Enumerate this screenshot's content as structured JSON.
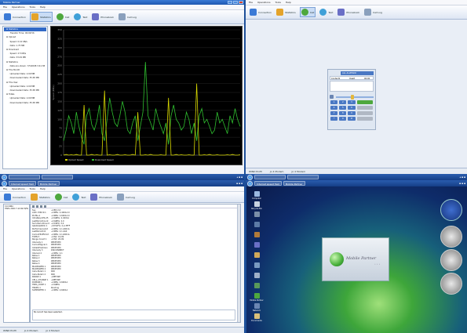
{
  "panes": {
    "tl": {
      "title": "Mobile Partner",
      "menu": [
        "File",
        "Operations",
        "Tools",
        "Help"
      ],
      "toolbar": [
        "Connection",
        "Statistics",
        "Call",
        "Text",
        "Phonebook",
        "Call Log"
      ],
      "tree": [
        {
          "text": "Statistics",
          "level": 0,
          "selected": true
        },
        {
          "text": "Transfer Time: 00:09:56",
          "level": 1
        },
        {
          "text": "Upload",
          "level": 0
        },
        {
          "text": "Speed: 0.10 KB/s",
          "level": 1
        },
        {
          "text": "Data: 1.75 MB",
          "level": 1
        },
        {
          "text": "Download",
          "level": 0
        },
        {
          "text": "Speed: 2.5 KB/s",
          "level": 1
        },
        {
          "text": "Data: 33.29 MB",
          "level": 1
        },
        {
          "text": "Statistics",
          "level": 0
        },
        {
          "text": "Date are shown: 7/5/2008 3:41:38",
          "level": 1
        },
        {
          "text": "This Month",
          "level": 0
        },
        {
          "text": "Uploaded Data: 2.09 MB",
          "level": 1
        },
        {
          "text": "Downloaded Data: 35.58 MB",
          "level": 1
        },
        {
          "text": "This Year",
          "level": 0
        },
        {
          "text": "Uploaded Data: 2.09 MB",
          "level": 1
        },
        {
          "text": "Downloaded Data: 35.58 MB",
          "level": 1
        },
        {
          "text": "Totals",
          "level": 0
        },
        {
          "text": "Uploaded Data: 2.09 MB",
          "level": 1
        },
        {
          "text": "Downloaded Data: 35.58 MB",
          "level": 1
        }
      ],
      "legend": [
        "Upload Speed",
        "Download Speed"
      ],
      "status": [
        "WIND Profil",
        "Jo 4 Modem",
        "Jo 4 Modem"
      ]
    },
    "tr": {
      "menu": [
        "File",
        "Operations",
        "Tools",
        "Help"
      ],
      "toolbar": [
        "Connection",
        "Statistics",
        "Call",
        "Text",
        "Phonebook",
        "Call Log"
      ],
      "dialer_header": "ALL ALLESSIO",
      "dialer_row": [
        "Contact1",
        "Dealt",
        "00:00"
      ],
      "keys": [
        "1",
        "2",
        "3",
        "4",
        "5",
        "6",
        "7",
        "8",
        "9",
        "*",
        "0",
        "#"
      ],
      "status": [
        "WIND Profil",
        "Jo 4 Modem",
        "Jo 4 Modem"
      ]
    },
    "bl": {
      "taskbar": [
        "Internet speed Test",
        "Mobile Partner"
      ],
      "menu": [
        "File",
        "Operations",
        "Tools",
        "Help"
      ],
      "toolbar": [
        "Connection",
        "Statistics",
        "Call",
        "Text",
        "Phonebook",
        "Call Log"
      ],
      "list": [
        "ComANA",
        "HSPA 2000 7.2mbit B/W/2014"
      ],
      "rows": [
        [
          "Sys",
          "+CEQ:2,0"
        ],
        [
          "Auth: PIN=0:1",
          "+CREG: 2,4001A:0"
        ],
        [
          "Profile-1",
          "+CREG: 2,6001A:0"
        ],
        [
          "IntraReq-CPS-25",
          "+CGREG: 2,4001A"
        ],
        [
          "LastPeriodCount",
          "+CGREG: 2,0"
        ],
        [
          "Sum-PeriodCount",
          "+CCSEQ: 3,0"
        ],
        [
          "GetAbleAttrib 1",
          "+SYSCFG: 2,2,3FFF"
        ],
        [
          "PerformanceCnt",
          "+CREG: 2,1,4001A"
        ],
        [
          "LastPeriodCnt",
          "+CREG: 2,1,4A0"
        ],
        [
          "CurrentTrafficCnt",
          "+CREG: 2,1,6001A"
        ],
        [
          "TOPN 3",
          "+CSQ: 19,99"
        ],
        [
          "Range Count 1",
          "+CSQ: 20,99"
        ],
        [
          "Intervaly 1",
          "RECEIVED"
        ],
        [
          "CurrentSignal 1",
          "RECEIVED"
        ],
        [
          "InitialLFreshAsn",
          "RECEIVED"
        ],
        [
          "Intervaly 3",
          "DISCONNECT"
        ],
        [
          "Interval 4",
          "+CREG: 2,1"
        ],
        [
          "Rates 1",
          "RECEIVED"
        ],
        [
          "Rates 2",
          "RECEIVED"
        ],
        [
          "Rates 3",
          "RECEIVED"
        ],
        [
          "Rates 4",
          "RECEIVED"
        ],
        [
          "MAXPOWER 1",
          "RECEIVED"
        ],
        [
          "MAXPOWER 2",
          "RECEIVED"
        ],
        [
          "Cell+Param 1",
          "R00"
        ],
        [
          "Cell+Param 2",
          "R00"
        ],
        [
          "PARAM 1",
          "+REFUSE"
        ],
        [
          "CELL_CHANGE 1",
          "+REFUSE"
        ],
        [
          "DOMAIN 1",
          "+CREG: 2,6001A"
        ],
        [
          "HSPA_CODE 1",
          "+CGREG"
        ],
        [
          "HSDPA 1",
          "Pending"
        ],
        [
          "SUPPORTED 1",
          "+CREG: 2,6001A"
        ]
      ],
      "footer": "No record has been selected.",
      "status": [
        "WIND Profil",
        "Jo 4 Modem",
        "Jo 4 Modem"
      ]
    },
    "br": {
      "taskbar": [
        "Internet speed Test",
        "Mobile Partner"
      ],
      "icons": [
        "Computer",
        "Recycle Bin",
        "",
        "",
        "",
        "",
        "",
        "",
        "",
        "",
        "Mobile Partner",
        "Network",
        "Documents"
      ],
      "splash": "Mobile Partner"
    }
  },
  "chart_data": {
    "type": "line",
    "title": "",
    "xlabel": "",
    "ylabel": "Speed (KB/s)",
    "ylim": [
      0,
      350
    ],
    "yticks": [
      0,
      25,
      50,
      75,
      100,
      125,
      150,
      175,
      200,
      225,
      250,
      275,
      300,
      325,
      350
    ],
    "series": [
      {
        "name": "Upload Speed",
        "color": "#d8d800",
        "values": [
          0,
          2,
          0,
          1,
          0,
          2,
          0,
          0,
          140,
          0,
          0,
          2,
          0,
          1,
          0,
          0,
          180,
          0,
          1,
          0,
          0,
          2,
          0,
          0,
          1,
          0,
          0,
          2,
          0,
          120,
          0,
          0,
          1,
          0,
          2,
          0,
          0,
          0,
          1,
          0,
          0,
          160,
          0,
          0,
          2,
          0,
          1,
          0,
          0,
          1,
          0,
          0,
          200,
          0,
          0,
          1,
          0,
          2,
          0,
          0,
          1,
          0,
          0,
          0,
          1,
          0,
          2,
          0,
          0,
          1
        ]
      },
      {
        "name": "Download Speed",
        "color": "#2fbf2f",
        "values": [
          40,
          70,
          110,
          90,
          60,
          120,
          80,
          50,
          30,
          110,
          130,
          85,
          70,
          95,
          140,
          60,
          40,
          100,
          160,
          120,
          90,
          80,
          110,
          150,
          120,
          70,
          60,
          90,
          110,
          40,
          80,
          120,
          260,
          110,
          90,
          70,
          130,
          100,
          80,
          60,
          90,
          30,
          110,
          140,
          100,
          90,
          70,
          80,
          120,
          100,
          60,
          90,
          40,
          110,
          130,
          90,
          100,
          80,
          60,
          70,
          120,
          90,
          100,
          80,
          60,
          110,
          90,
          130,
          100,
          80
        ]
      }
    ],
    "legend": "bottom"
  },
  "colors": {
    "accent": "#1e58b0",
    "taskbar": "#153e86"
  }
}
